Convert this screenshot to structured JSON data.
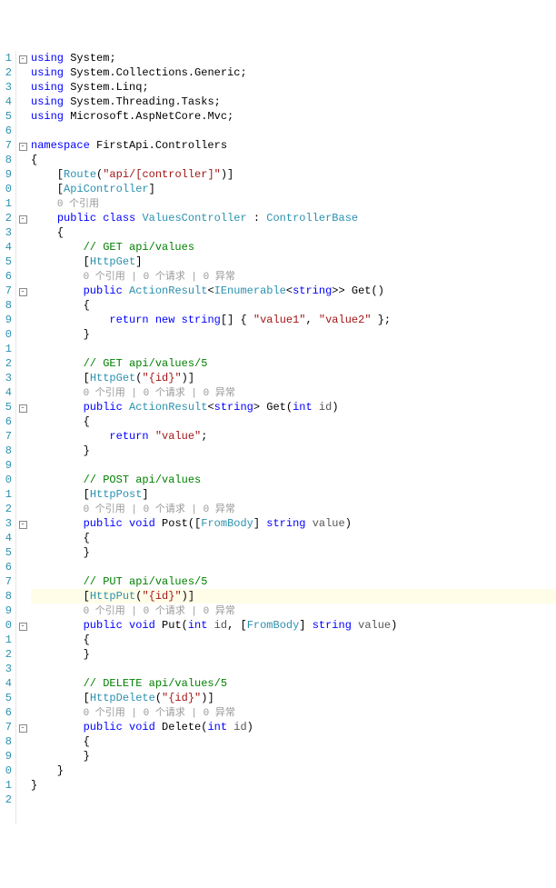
{
  "lineStart": 1,
  "highlightLine": 33,
  "usings": {
    "u1": "using",
    "u2": "System",
    "u3": "System.Collections.Generic",
    "u4": "System.Linq",
    "u5": "System.Threading.Tasks",
    "u6": "Microsoft.AspNetCore.Mvc"
  },
  "ns": {
    "kw": "namespace",
    "name": "FirstApi.Controllers"
  },
  "attrs": {
    "route": "Route",
    "routeArg": "\"api/[controller]\"",
    "apiController": "ApiController",
    "httpGet": "HttpGet",
    "httpGetId": "\"{id}\"",
    "httpPost": "HttpPost",
    "httpPut": "HttpPut",
    "httpPutId": "\"{id}\"",
    "httpDelete": "HttpDelete",
    "httpDeleteId": "\"{id}\"",
    "fromBody": "FromBody"
  },
  "codelens": {
    "class": "0 个引用",
    "method": "0 个引用 | 0 个请求 | 0 异常"
  },
  "cls": {
    "public": "public",
    "classKw": "class",
    "name": "ValuesController",
    "base": "ControllerBase"
  },
  "get1": {
    "cmt": "// GET api/values",
    "retType1": "ActionResult",
    "retType2": "IEnumerable",
    "retType3": "string",
    "name": "Get",
    "ret": "return",
    "new": "new",
    "strType": "string",
    "v1": "\"value1\"",
    "v2": "\"value2\""
  },
  "get2": {
    "cmt": "// GET api/values/5",
    "retType1": "ActionResult",
    "retType2": "string",
    "name": "Get",
    "paramType": "int",
    "paramName": "id",
    "ret": "return",
    "val": "\"value\""
  },
  "post": {
    "cmt": "// POST api/values",
    "void": "void",
    "name": "Post",
    "paramType": "string",
    "paramName": "value"
  },
  "put": {
    "cmt": "// PUT api/values/5",
    "void": "void",
    "name": "Put",
    "p1Type": "int",
    "p1Name": "id",
    "p2Type": "string",
    "p2Name": "value"
  },
  "del": {
    "cmt": "// DELETE api/values/5",
    "void": "void",
    "name": "Delete",
    "pType": "int",
    "pName": "id"
  }
}
